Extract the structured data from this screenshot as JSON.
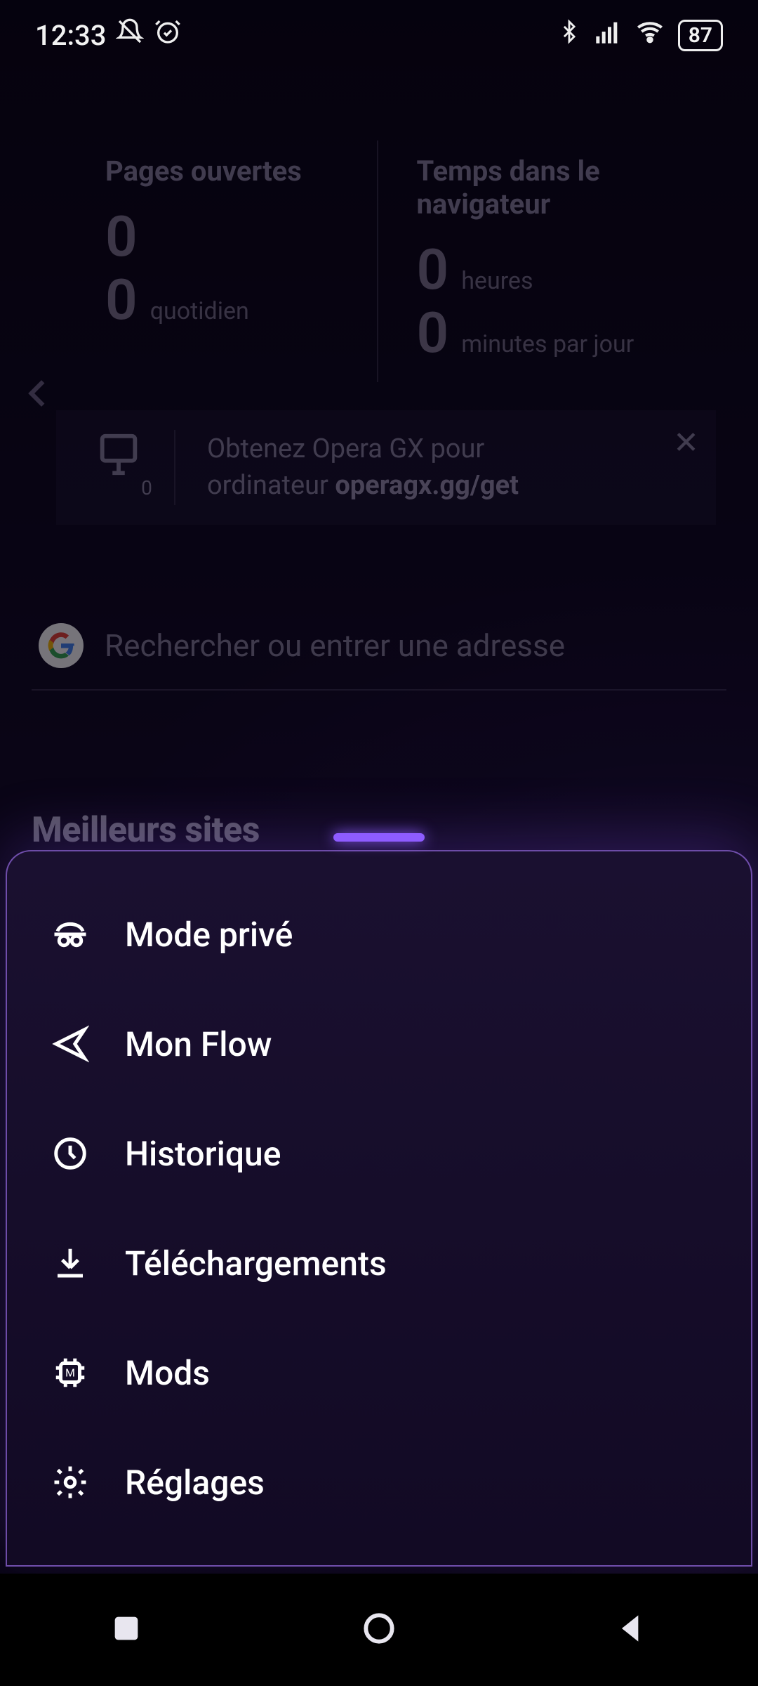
{
  "status": {
    "time": "12:33",
    "battery": "87"
  },
  "stats": {
    "pages_label": "Pages ouvertes",
    "pages_value": "0",
    "pages_daily_value": "0",
    "pages_daily_unit": "quotidien",
    "time_label": "Temps dans le navigateur",
    "hours_value": "0",
    "hours_unit": "heures",
    "minutes_value": "0",
    "minutes_unit": "minutes par jour"
  },
  "promo": {
    "devices_count": "0",
    "line1": "Obtenez Opera GX pour",
    "line2_prefix": "ordinateur ",
    "line2_bold": "operagx.gg/get"
  },
  "search": {
    "placeholder": "Rechercher ou entrer une adresse"
  },
  "top_sites": {
    "heading": "Meilleurs sites"
  },
  "menu": {
    "private": "Mode privé",
    "flow": "Mon Flow",
    "history": "Historique",
    "downloads": "Téléchargements",
    "mods": "Mods",
    "settings": "Réglages"
  }
}
